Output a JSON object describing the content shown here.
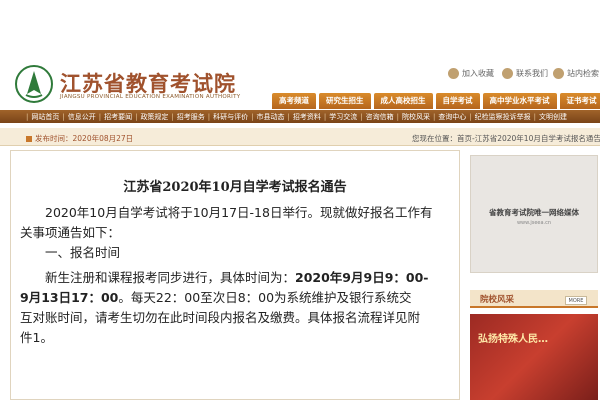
{
  "site": {
    "title": "江苏省教育考试院",
    "subtitle": "JIANGSU PROVINCIAL EDUCATION EXAMINATION AUTHORITY"
  },
  "utility": {
    "favorite": "加入收藏",
    "contact": "联系我们",
    "search": "站内检索"
  },
  "tabs": [
    "高考频道",
    "研究生招生",
    "成人高校招生",
    "自学考试",
    "高中学业水平考试",
    "证书考试"
  ],
  "nav": [
    "网站首页",
    "信息公开",
    "招考要闻",
    "政策规定",
    "招考服务",
    "科研与评价",
    "市县动态",
    "招考资料",
    "学习交流",
    "咨询信箱",
    "院校风采",
    "查询中心",
    "纪检监察投诉举报",
    "文明创建"
  ],
  "info": {
    "date_label": "发布时间：2020年08月27日",
    "breadcrumb": "您现在位置：首页-江苏省2020年10月自学考试报名通告"
  },
  "article": {
    "title": "江苏省2020年10月自学考试报名通告",
    "line1": "2020年10月自学考试将于10月17日-18日举行。现就做好报名工作有",
    "line2": "关事项通告如下：",
    "line3": "一、报名时间",
    "line4_a": "新生注册和课程报考同步进行，具体时间为：",
    "line4_b": "2020年9月9日9：00-",
    "line5_a": "9月13日17：00",
    "line5_b": "。每天22：00至次日8：00为系统维护及银行系统交",
    "line6": "互对账时间，请考生切勿在此时间段内报名及缴费。具体报名流程详见附",
    "line7": "件1。"
  },
  "sidebar": {
    "ad_text": "省教育考试院唯一网络媒体",
    "ad_url": "www.jseea.cn",
    "section_title": "院校风采",
    "more": "MORE",
    "photo_caption": "弘扬特殊人民…"
  }
}
